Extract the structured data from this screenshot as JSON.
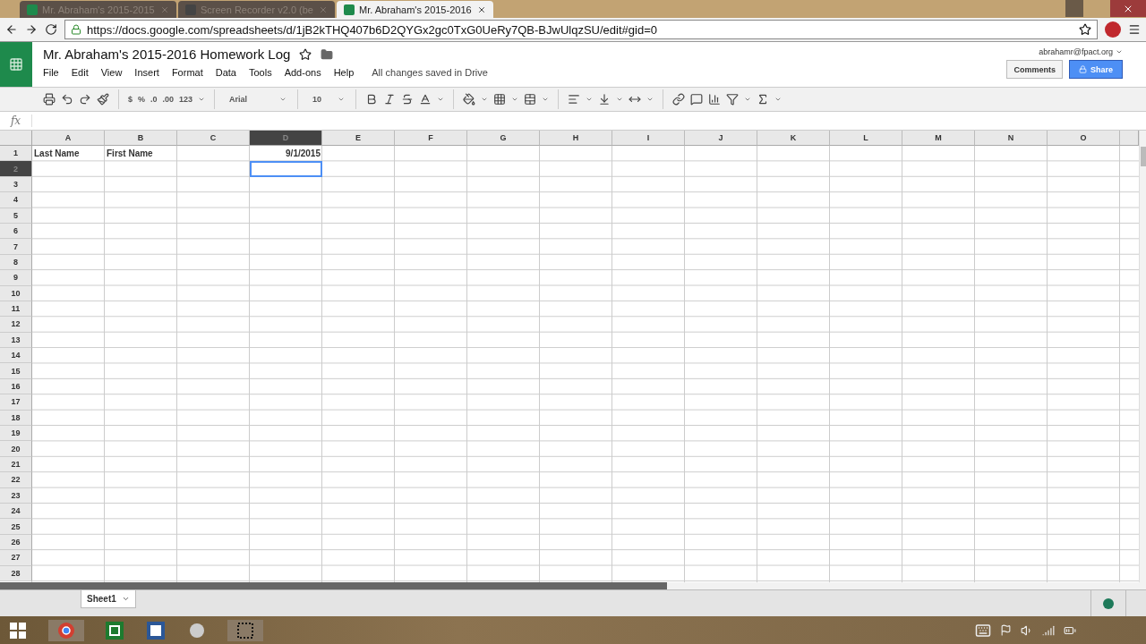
{
  "browser": {
    "tabs": [
      {
        "title": "Mr. Abraham's 2015-2015",
        "kind": "sheets",
        "selected": false
      },
      {
        "title": "Screen Recorder v2.0 (be",
        "kind": "recorder",
        "selected": false
      },
      {
        "title": "Mr. Abraham's 2015-2016",
        "kind": "sheets",
        "selected": true
      }
    ],
    "url": "https://docs.google.com/spreadsheets/d/1jB2kTHQ407b6D2QYGx2gc0TxG0UeRy7QB-BJwUlqzSU/edit#gid=0"
  },
  "document": {
    "title": "Mr. Abraham's 2015-2016 Homework Log",
    "account": "abrahamr@fpact.org",
    "status": "All changes saved in Drive",
    "comments_button": "Comments",
    "share_button": "Share"
  },
  "menu": [
    "File",
    "Edit",
    "View",
    "Insert",
    "Format",
    "Data",
    "Tools",
    "Add-ons",
    "Help"
  ],
  "toolbar": {
    "number_formats": [
      "$",
      "%",
      ".0",
      ".00",
      "123"
    ],
    "font": "Arial",
    "font_size": "10"
  },
  "formula_bar": {
    "label": "fx"
  },
  "grid": {
    "columns": [
      {
        "label": "A",
        "selected": false
      },
      {
        "label": "B",
        "selected": false
      },
      {
        "label": "C",
        "selected": false
      },
      {
        "label": "D",
        "selected": true
      },
      {
        "label": "E",
        "selected": false
      },
      {
        "label": "F",
        "selected": false
      },
      {
        "label": "G",
        "selected": false
      },
      {
        "label": "H",
        "selected": false
      },
      {
        "label": "I",
        "selected": false
      },
      {
        "label": "J",
        "selected": false
      },
      {
        "label": "K",
        "selected": false
      },
      {
        "label": "L",
        "selected": false
      },
      {
        "label": "M",
        "selected": false
      },
      {
        "label": "N",
        "selected": false
      },
      {
        "label": "O",
        "selected": false
      }
    ],
    "rows": [
      {
        "label": "1",
        "selected": false,
        "cells": [
          {
            "text": "Last Name",
            "kind": "text"
          },
          {
            "text": "First Name",
            "kind": "text"
          },
          {},
          {
            "text": "9/1/2015",
            "kind": "date"
          }
        ]
      },
      {
        "label": "2",
        "selected": true,
        "cells": [
          {},
          {},
          {},
          {
            "selected": true
          }
        ]
      },
      {
        "label": "3",
        "selected": false
      },
      {
        "label": "4",
        "selected": false
      },
      {
        "label": "5",
        "selected": false
      },
      {
        "label": "6",
        "selected": false
      },
      {
        "label": "7",
        "selected": false
      },
      {
        "label": "8",
        "selected": false
      },
      {
        "label": "9",
        "selected": false
      },
      {
        "label": "10",
        "selected": false
      },
      {
        "label": "11",
        "selected": false
      },
      {
        "label": "12",
        "selected": false
      },
      {
        "label": "13",
        "selected": false
      },
      {
        "label": "14",
        "selected": false
      },
      {
        "label": "15",
        "selected": false
      },
      {
        "label": "16",
        "selected": false
      },
      {
        "label": "17",
        "selected": false
      },
      {
        "label": "18",
        "selected": false
      },
      {
        "label": "19",
        "selected": false
      },
      {
        "label": "20",
        "selected": false
      },
      {
        "label": "21",
        "selected": false
      },
      {
        "label": "22",
        "selected": false
      },
      {
        "label": "23",
        "selected": false
      },
      {
        "label": "24",
        "selected": false
      },
      {
        "label": "25",
        "selected": false
      },
      {
        "label": "26",
        "selected": false
      },
      {
        "label": "27",
        "selected": false
      },
      {
        "label": "28",
        "selected": false
      }
    ]
  },
  "sheet_tabs": [
    {
      "label": "Sheet1",
      "selected": true
    }
  ]
}
